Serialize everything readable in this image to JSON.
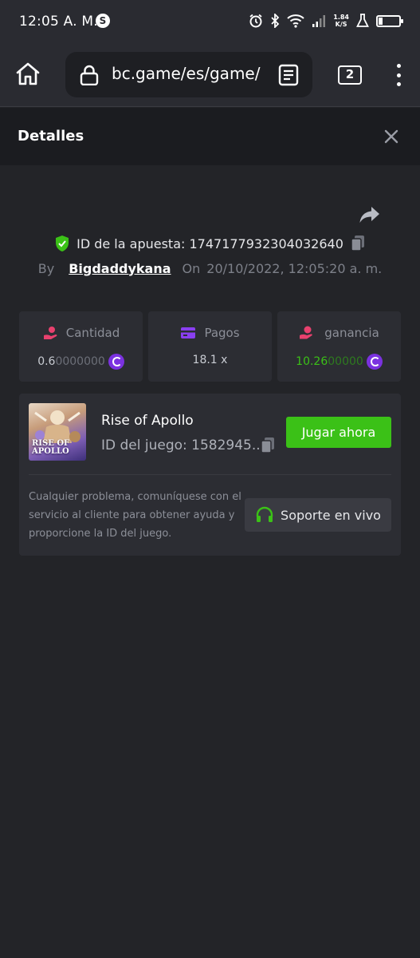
{
  "status_bar": {
    "time": "12:05 A. M.",
    "app_badge": "S",
    "speed": "1.84",
    "speed_unit": "K/S"
  },
  "browser": {
    "url": "bc.game/es/game/",
    "tab_count": "2"
  },
  "panel": {
    "title": "Detalles"
  },
  "bet": {
    "id_label": "ID de la apuesta: 1747177932304032640",
    "by_label": "By",
    "username": "Bigdaddykana",
    "on_label": "On",
    "datetime": "20/10/2022, 12:05:20 a. m."
  },
  "stats": {
    "amount": {
      "label": "Cantidad",
      "value_main": "0.6",
      "value_tail": "0000000",
      "icon_color": "#e8416e"
    },
    "payout": {
      "label": "Pagos",
      "value": "18.1 x",
      "icon_color": "#8a3ff0"
    },
    "profit": {
      "label": "ganancia",
      "value_main": "10.26",
      "value_tail": "00000",
      "icon_color": "#e8416e"
    }
  },
  "game": {
    "thumb_text_1": "RISE OF",
    "thumb_text_2": "APOLLO",
    "name": "Rise of Apollo",
    "id_label": "ID del juego: 1582945...",
    "play_label": "Jugar ahora",
    "help_text": "Cualquier problema, comuníquese con el servicio al cliente para obtener ayuda y proporcione la ID del juego.",
    "support_label": "Soporte en vivo"
  },
  "colors": {
    "accent_green": "#3bc117",
    "profit_green": "#3bc117",
    "coin_purple": "#7b32e0"
  }
}
